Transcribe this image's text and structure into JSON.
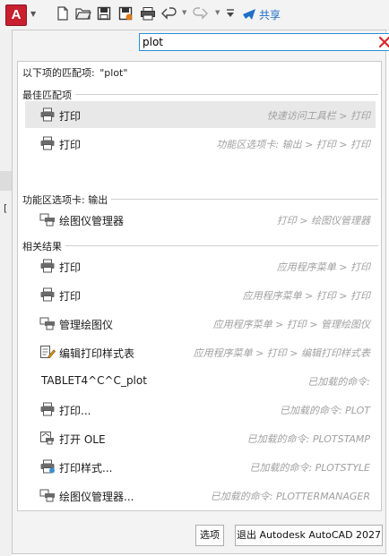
{
  "app": {
    "logo_letter": "A",
    "logo_color": "#c8202f"
  },
  "toolbar": {
    "icons": [
      "new-icon",
      "open-icon",
      "save-icon",
      "save-as-icon",
      "plot-icon",
      "undo-icon",
      "redo-icon",
      "customize-icon",
      "share-icon"
    ],
    "share_label": "共享",
    "share_color": "#1f6fc6"
  },
  "search": {
    "value": "plot",
    "placeholder": ""
  },
  "results": {
    "header_prefix": "以下项的匹配项:",
    "header_query": "\"plot\"",
    "sections": [
      {
        "id": "best",
        "label": "最佳匹配项"
      },
      {
        "id": "ribbon",
        "label": "功能区选项卡: 输出"
      },
      {
        "id": "related",
        "label": "相关结果"
      }
    ],
    "items": [
      {
        "icon": "printer-icon",
        "name": "打印",
        "path": "快速访问工具栏 > 打印",
        "selected": true
      },
      {
        "icon": "printer-icon",
        "name": "打印",
        "path": "功能区选项卡: 输出 > 打印 > 打印"
      },
      {
        "icon": "plotter-manager-icon",
        "name": "绘图仪管理器",
        "path": "打印 > 绘图仪管理器"
      },
      {
        "icon": "printer-icon",
        "name": "打印",
        "path": "应用程序菜单 > 打印"
      },
      {
        "icon": "printer-icon",
        "name": "打印",
        "path": "应用程序菜单 > 打印 > 打印"
      },
      {
        "icon": "plotter-manager-icon",
        "name": "管理绘图仪",
        "path": "应用程序菜单 > 打印 > 管理绘图仪"
      },
      {
        "icon": "edit-plot-style-icon",
        "name": "编辑打印样式表",
        "path": "应用程序菜单 > 打印 > 编辑打印样式表"
      },
      {
        "icon": "",
        "name": "TABLET4^C^C_plot",
        "path": "已加载的命令:"
      },
      {
        "icon": "printer-icon",
        "name": "打印...",
        "path": "已加载的命令: PLOT"
      },
      {
        "icon": "plotstamp-icon",
        "name": "打开 OLE",
        "path": "已加载的命令: PLOTSTAMP"
      },
      {
        "icon": "plot-style-icon",
        "name": "打印样式...",
        "path": "已加载的命令: PLOTSTYLE"
      },
      {
        "icon": "plotter-manager-icon",
        "name": "绘图仪管理器...",
        "path": "已加载的命令: PLOTTERMANAGER"
      }
    ]
  },
  "footer": {
    "options_label": "选项",
    "exit_label": "退出 Autodesk AutoCAD 2027"
  }
}
